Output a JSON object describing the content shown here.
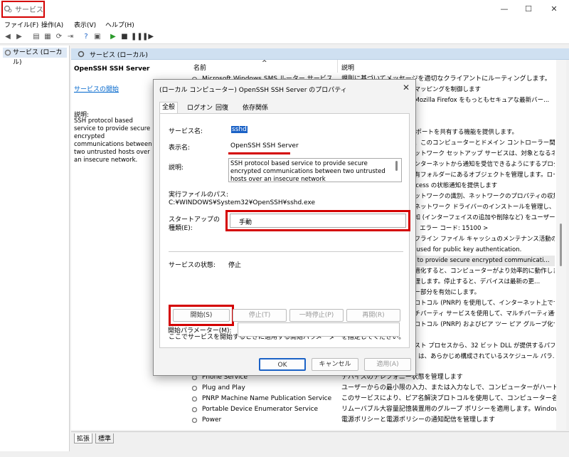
{
  "window": {
    "title": "サービス",
    "minimize": "—",
    "maximize": "☐",
    "close": "✕"
  },
  "menu": [
    "ファイル(F)",
    "操作(A)",
    "表示(V)",
    "ヘルプ(H)"
  ],
  "tree": {
    "root": "サービス (ローカル)"
  },
  "pane": {
    "header": "サービス (ローカル)",
    "selected_title": "OpenSSH SSH Server",
    "start_link": "サービスの開始",
    "desc_label": "説明:",
    "desc_body": "SSH protocol based service to provide secure encrypted communications between two untrusted hosts over an insecure network."
  },
  "list": {
    "col_name": "名前",
    "col_desc": "説明",
    "sort_glyph": "^",
    "rows_top": [
      {
        "name": "Microsoft Windows SMS ルーター サービス",
        "desc": "規則に基づいてメッセージを適切なクライアントにルーティングします。"
      }
    ],
    "right_descs": [
      "とマッピングを制御します",
      "、Mozilla Firefox をもっともセキュアな最新バー...",
      "",
      "",
      "IP ポートを共有する機能を提供します。",
      "た、このコンピューターとドメイン コントローラー間で...",
      "ネットワーク セットアップ サービスは、対象となるネットワークに...",
      "インターネットから通知を受信できるようにするプログラ...",
      "共有フォルダーにあるオブジェクトを管理します。ローカ...",
      "Access の状態通知を提供します",
      "ネットワークの識別、ネットワークのプロパティの収集...",
      "、ネットワーク ドライバーのインストールを管理し、低...",
      "通知 (インターフェイスの追加や削除など) をユーザー...",
      "す。エラー コード: 15100 >",
      "オフライン ファイル キャッシュのメンテナンス活動の...",
      "nt used for public key authentication.",
      "ce to provide secure encrypted communicati...",
      "最適化すると、コンピューターがより効率的に動作しま...",
      "管理します。停止すると、デバイスは最新の更...",
      "ガー部分を有効にします。",
      "プロトコル (PNRP) を使用して、インターネット上でサ...",
      "ルチパーティ サービスを使用して、マルチパーティ通信...",
      "プロトコル (PNRP) およびピア ツー ピア グループ化サー...",
      "",
      "ホスト プロセスから、32 ビット DLL が提供するパフォー...",
      "rts は、あらかじめ構成されているスケジュール パラ..."
    ],
    "rows_bottom": [
      {
        "name": "Phone Service",
        "desc": "デバイスのテレフォニー状態を管理します"
      },
      {
        "name": "Plug and Play",
        "desc": "ユーザーからの最小限の入力、または入力なしで、コンピューターがハードウェアの..."
      },
      {
        "name": "PNRP Machine Name Publication Service",
        "desc": "このサービスにより、ピア名解決プロトコルを使用して、コンピューター名が公開され..."
      },
      {
        "name": "Portable Device Enumerator Service",
        "desc": "リムーバブル大容量記憶装置用のグループ ポリシーを適用します。Windows M..."
      },
      {
        "name": "Power",
        "desc": "電源ポリシーと電源ポリシーの通知配信を管理します"
      }
    ]
  },
  "bottom_tabs": [
    "拡張",
    "標準"
  ],
  "dialog": {
    "title": "(ローカル コンピューター) OpenSSH SSH Server のプロパティ",
    "tabs": [
      "全般",
      "ログオン",
      "回復",
      "依存関係"
    ],
    "service_name_label": "サービス名:",
    "service_name": "sshd",
    "display_name_label": "表示名:",
    "display_name": "OpenSSH SSH Server",
    "description_label": "説明:",
    "description": "SSH protocol based service to provide secure encrypted communications between two untrusted hosts over an insecure network",
    "exe_path_label": "実行ファイルのパス:",
    "exe_path": "C:¥WINDOWS¥System32¥OpenSSH¥sshd.exe",
    "startup_label_1": "スタートアップの",
    "startup_label_2": "種類(E):",
    "startup_value": "手動",
    "status_label": "サービスの状態:",
    "status_value": "停止",
    "btn_start": "開始(S)",
    "btn_stop": "停止(T)",
    "btn_pause": "一時停止(P)",
    "btn_resume": "再開(R)",
    "hint": "ここでサービスを開始するときに適用する開始パラメーターを指定してください。",
    "param_label": "開始パラメーター(M):",
    "param_value": "",
    "ok": "OK",
    "cancel": "キャンセル",
    "apply": "適用(A)"
  },
  "colors": {
    "highlight_red": "#d40000",
    "accent_blue": "#1b62c6"
  }
}
